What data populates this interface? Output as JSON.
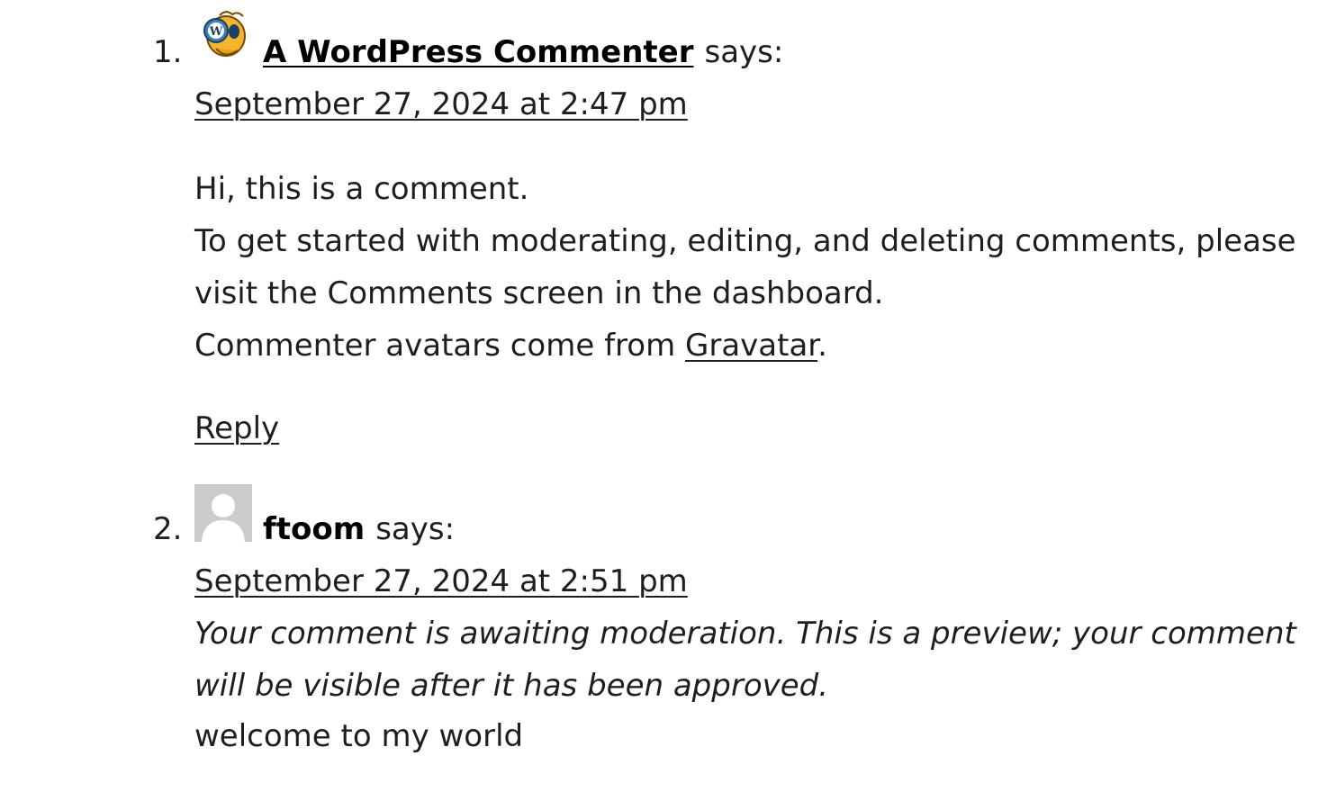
{
  "comments": [
    {
      "number": "1.",
      "author": "A WordPress Commenter",
      "says": "says:",
      "date": "September 27, 2024 at 2:47 pm",
      "body": {
        "line1": "Hi, this is a comment.",
        "line2": "To get started with moderating, editing, and deleting comments, please visit the Comments screen in the dashboard.",
        "line3_before": "Commenter avatars come from ",
        "line3_link": "Gravatar",
        "line3_after": "."
      },
      "reply": "Reply",
      "avatar_icon": "wordpress-commenter-avatar-icon"
    },
    {
      "number": "2.",
      "author": "ftoom",
      "says": "says:",
      "date": "September 27, 2024 at 2:51 pm",
      "moderation": "Your comment is awaiting moderation. This is a preview; your comment will be visible after it has been approved.",
      "body": "welcome to my world",
      "avatar_icon": "default-avatar-icon"
    }
  ],
  "colors": {
    "text": "#1e1e1e",
    "avatar_gray": "#cccccc",
    "avatar_gold": "#f2b52c"
  }
}
